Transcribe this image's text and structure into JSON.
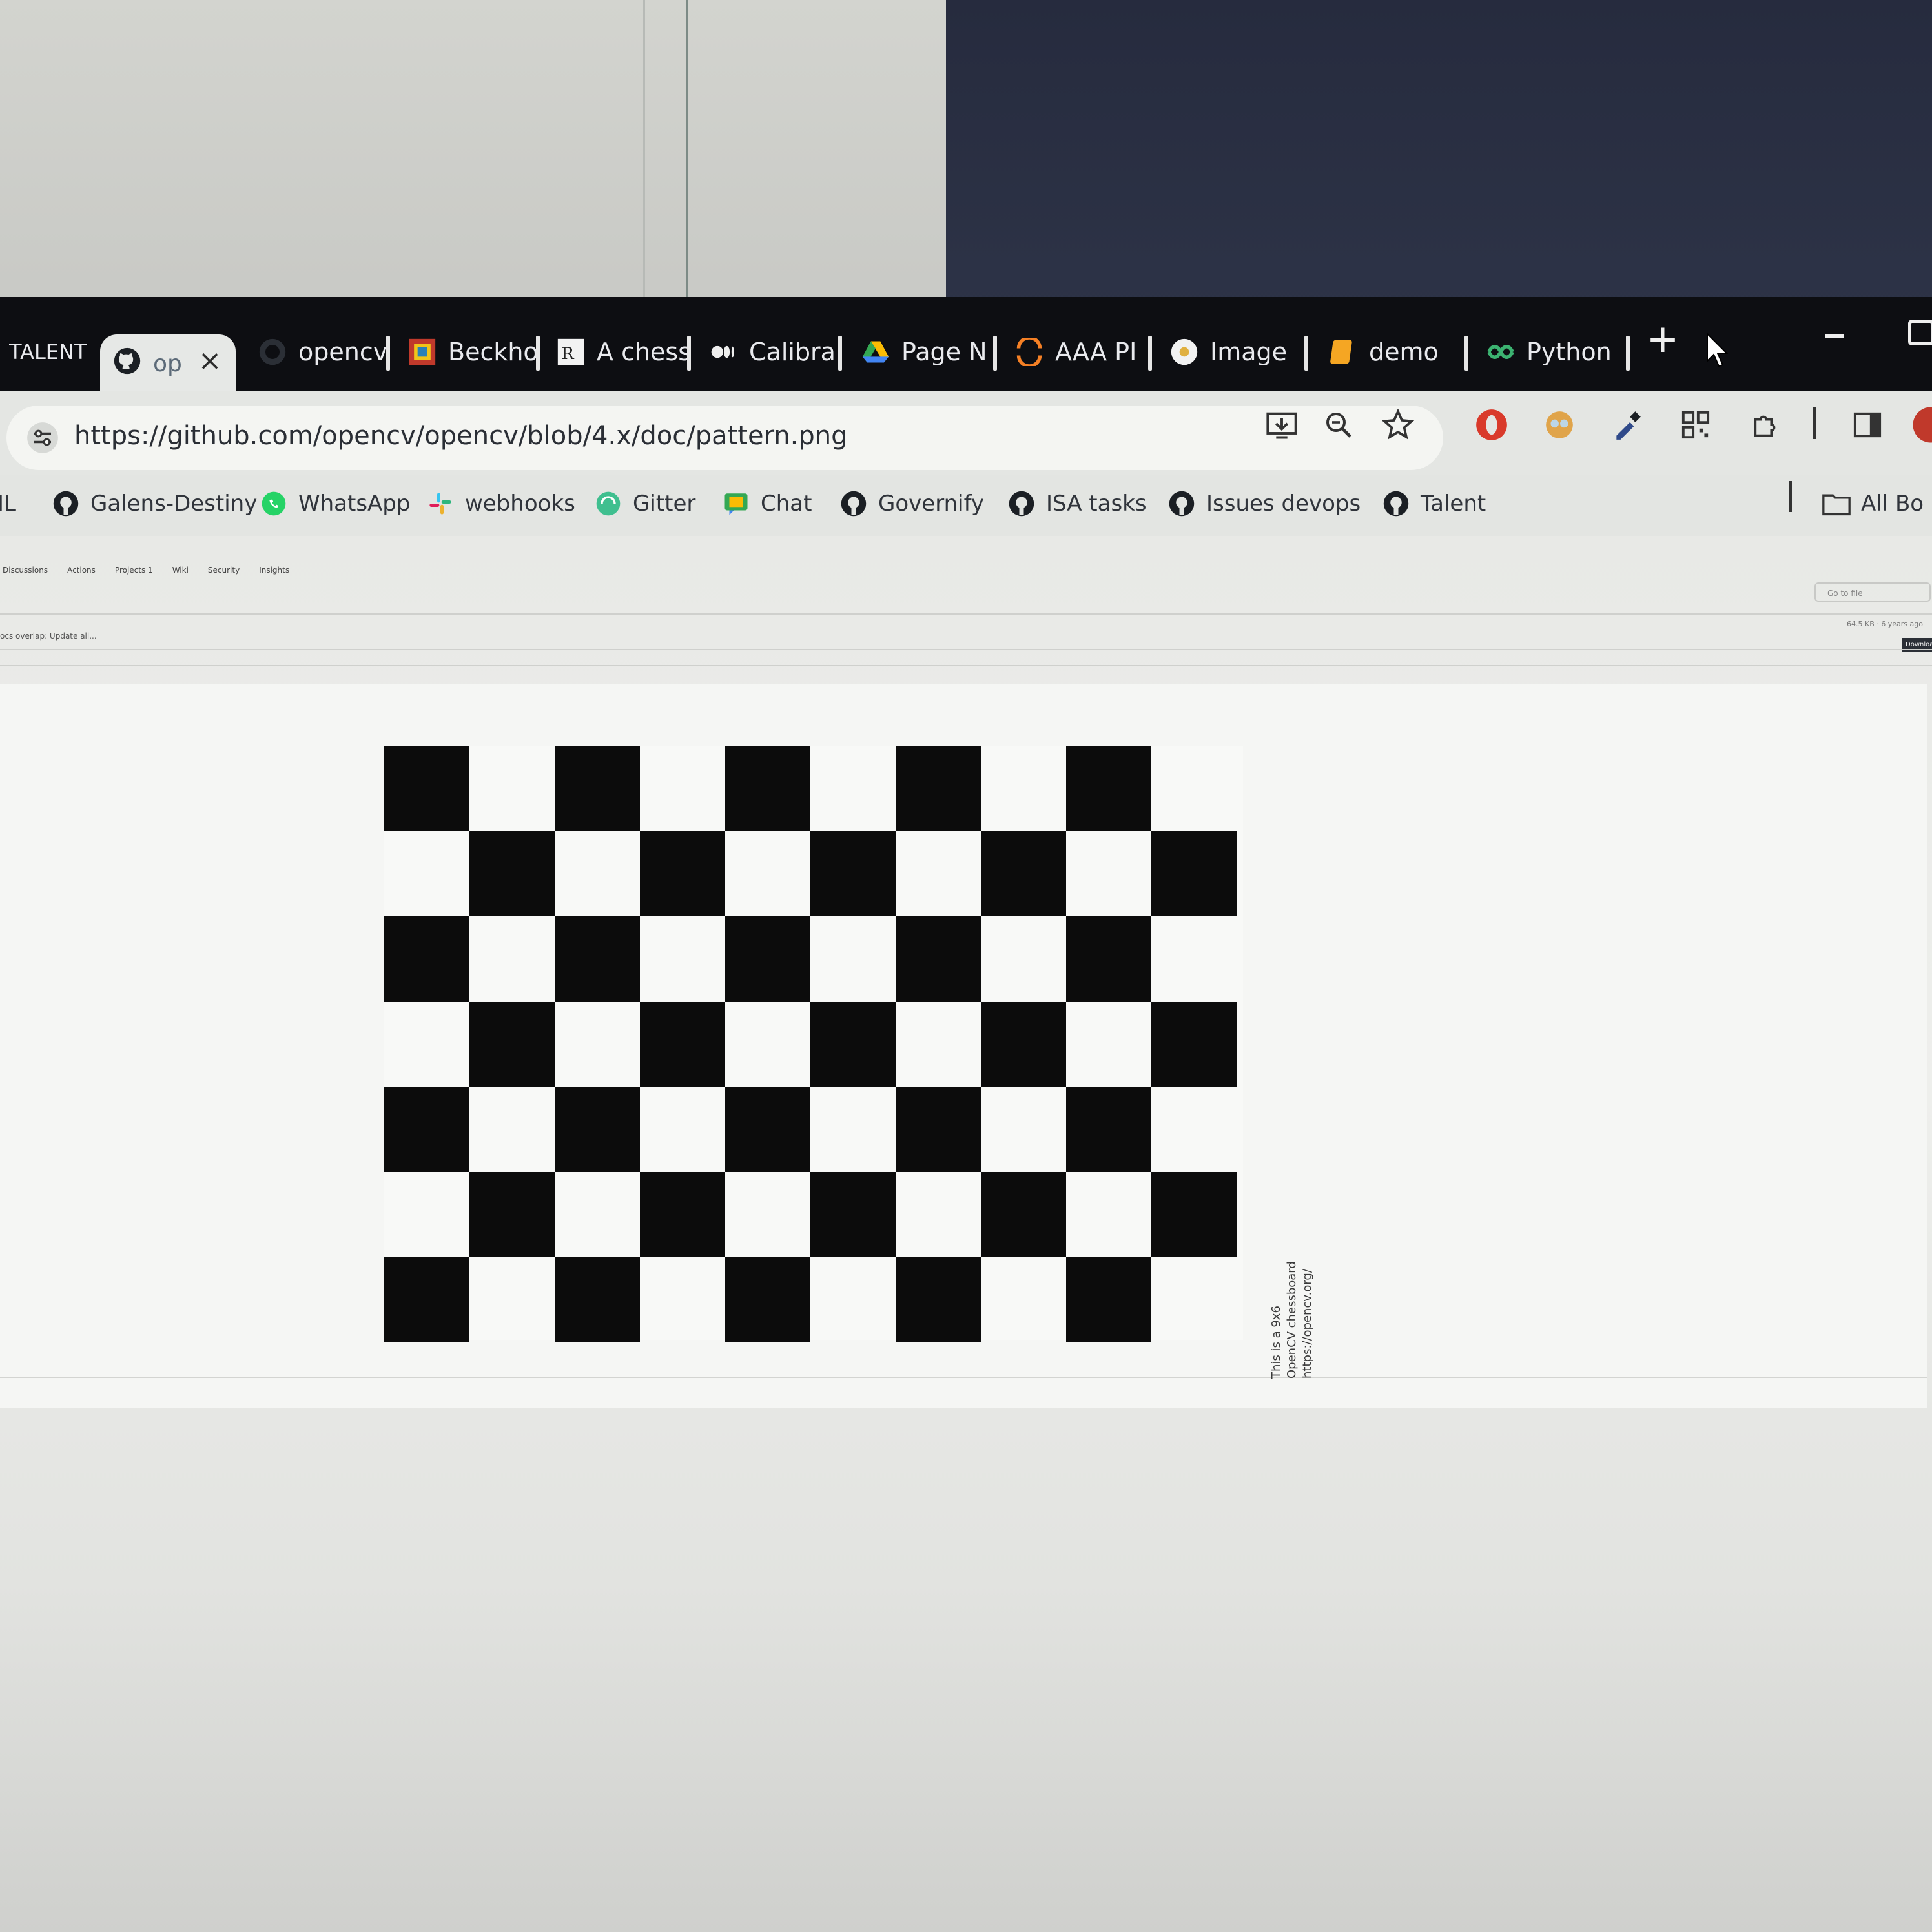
{
  "browser": {
    "tabs": [
      {
        "title": "TALENT",
        "icon": "talent-icon"
      },
      {
        "title": "op",
        "icon": "github-icon",
        "active": true
      },
      {
        "title": "opencv",
        "icon": "github-icon"
      },
      {
        "title": "Beckho",
        "icon": "beckhoff-icon"
      },
      {
        "title": "A chess",
        "icon": "rstudio-icon"
      },
      {
        "title": "Calibra",
        "icon": "medium-icon"
      },
      {
        "title": "Page N",
        "icon": "drive-icon"
      },
      {
        "title": "AAA PI",
        "icon": "swirl-icon"
      },
      {
        "title": "Image",
        "icon": "image-icon"
      },
      {
        "title": "demo",
        "icon": "notebook-icon"
      },
      {
        "title": "Python",
        "icon": "python-icon"
      }
    ],
    "tab_close_label": "×",
    "new_tab_label": "+",
    "url": "https://github.com/opencv/opencv/blob/4.x/doc/pattern.png"
  },
  "bookmarks": {
    "items": [
      {
        "label": "IL",
        "icon": ""
      },
      {
        "label": "Galens-Destiny",
        "icon": "github-icon"
      },
      {
        "label": "WhatsApp",
        "icon": "whatsapp-icon"
      },
      {
        "label": "webhooks",
        "icon": "slack-icon"
      },
      {
        "label": "Gitter",
        "icon": "gitter-icon"
      },
      {
        "label": "Chat",
        "icon": "chat-icon"
      },
      {
        "label": "Governify",
        "icon": "github-icon"
      },
      {
        "label": "ISA tasks",
        "icon": "github-icon"
      },
      {
        "label": "Issues devops",
        "icon": "github-icon"
      },
      {
        "label": "Talent",
        "icon": "github-icon"
      }
    ],
    "all_bookmarks_label": "All Bo"
  },
  "repo_nav": [
    "Discussions",
    "Actions",
    "Projects 1",
    "Wiki",
    "Security",
    "Insights"
  ],
  "commit_text": "ocs overlap: Update all...",
  "goto_file_placeholder": "Go to file",
  "file_meta": "64.5 KB · 6 years ago",
  "download_label": "Download",
  "image": {
    "caption_lines": [
      "This is a 9x6",
      "OpenCV chessboard",
      "https://opencv.org/"
    ],
    "board": {
      "rows": 7,
      "cols": 10,
      "square_color": "#0c0c0c",
      "background_color": "#ffffff"
    }
  },
  "colors": {
    "tabbar": "#0d0e12",
    "toolbar": "#e4e6e3",
    "accent_red": "#d93a2b"
  }
}
